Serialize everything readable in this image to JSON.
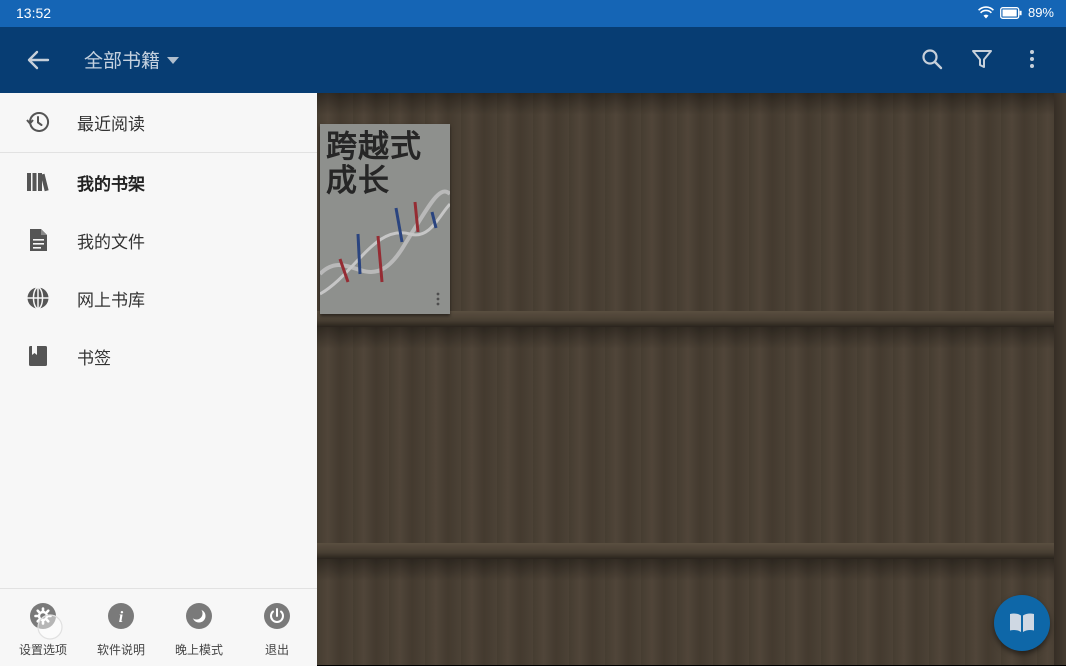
{
  "status_bar": {
    "time": "13:52",
    "battery": "89%"
  },
  "toolbar": {
    "title": "全部书籍"
  },
  "drawer": {
    "items": [
      {
        "label": "最近阅读",
        "icon": "history-icon"
      },
      {
        "label": "我的书架",
        "icon": "bookshelf-icon"
      },
      {
        "label": "我的文件",
        "icon": "file-icon"
      },
      {
        "label": "网上书库",
        "icon": "globe-icon"
      },
      {
        "label": "书签",
        "icon": "bookmark-icon"
      }
    ],
    "actions": [
      {
        "label": "设置选项",
        "icon": "gear-icon"
      },
      {
        "label": "软件说明",
        "icon": "info-icon"
      },
      {
        "label": "晚上模式",
        "icon": "moon-icon"
      },
      {
        "label": "退出",
        "icon": "power-icon"
      }
    ]
  },
  "book": {
    "title_line1": "跨越式",
    "title_line2": "成长"
  },
  "colors": {
    "status_bar": "#1565b5",
    "toolbar": "#073d73",
    "drawer": "#f7f7f7",
    "fab": "#0e67a8"
  }
}
